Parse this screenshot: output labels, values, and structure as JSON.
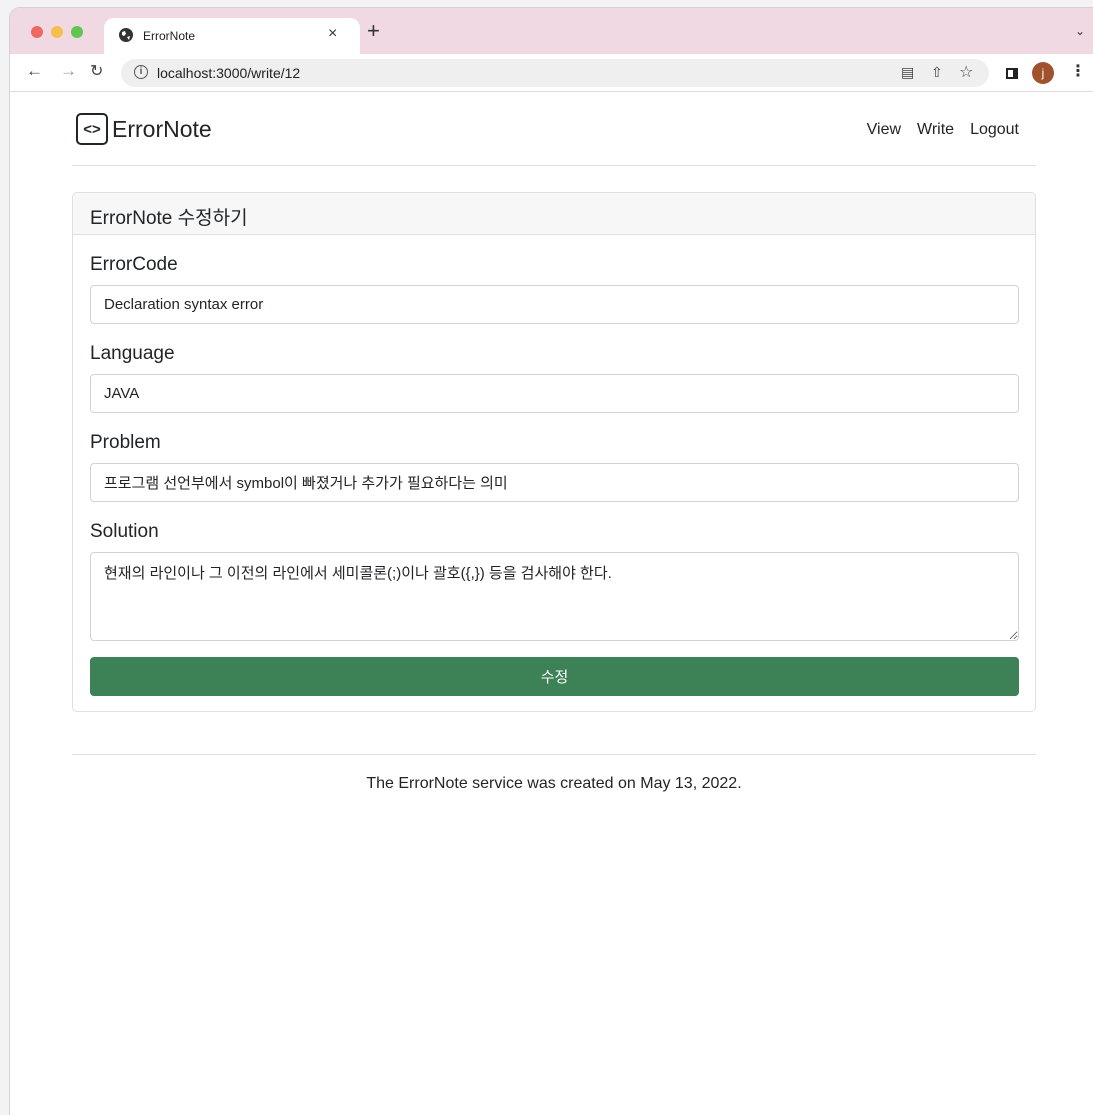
{
  "browser": {
    "tab_title": "ErrorNote",
    "tab_close": "×",
    "new_tab": "+",
    "url": "localhost:3000/write/12",
    "avatar_initial": "j"
  },
  "header": {
    "brand": "ErrorNote",
    "brand_icon": "<>",
    "nav": {
      "view": "View",
      "write": "Write",
      "logout": "Logout"
    }
  },
  "form": {
    "card_title": "ErrorNote 수정하기",
    "error_code_label": "ErrorCode",
    "error_code_value": "Declaration syntax error",
    "language_label": "Language",
    "language_value": "JAVA",
    "problem_label": "Problem",
    "problem_value": "프로그램 선언부에서 symbol이 빠졌거나 추가가 필요하다는 의미",
    "solution_label": "Solution",
    "solution_value": "현재의 라인이나 그 이전의 라인에서 세미콜론(;)이나 괄호({,}) 등을 검사해야 한다.",
    "submit_label": "수정"
  },
  "footer": {
    "text": "The ErrorNote service was created on May 13, 2022."
  },
  "colors": {
    "submit_button": "#3d8157",
    "tab_strip": "#f1d9e3"
  }
}
